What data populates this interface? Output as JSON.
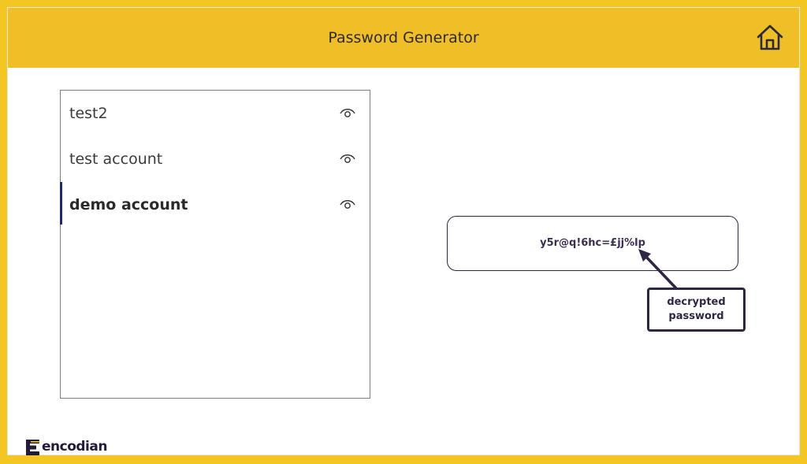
{
  "header": {
    "title": "Password Generator",
    "home_icon": "home-icon"
  },
  "accounts": [
    {
      "label": "test2",
      "icon": "eye-icon",
      "selected": false
    },
    {
      "label": "test account",
      "icon": "eye-icon",
      "selected": false
    },
    {
      "label": "demo account",
      "icon": "eye-icon",
      "selected": true
    }
  ],
  "password": {
    "value": "y5r@q!6hc=£jj%lp"
  },
  "annotation": {
    "line1": "decrypted",
    "line2": "password"
  },
  "brand": {
    "name": "encodian"
  },
  "colors": {
    "header": "#f0bf28",
    "border": "#f3c623",
    "accent": "#2f2644",
    "selection": "#1b2a6b"
  }
}
